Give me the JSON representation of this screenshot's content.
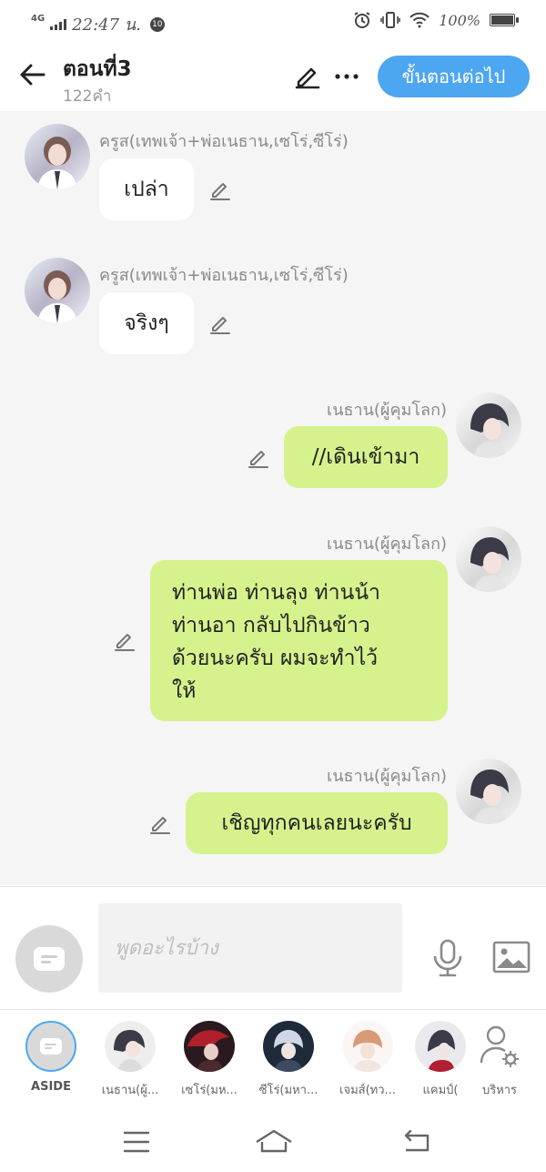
{
  "status_bar": {
    "network": "4G",
    "time": "22:47 น.",
    "notification_count": "10",
    "battery": "100%",
    "battery_level": 1.0
  },
  "header": {
    "title": "ตอนที่3",
    "word_count": "122คำ",
    "next_button": "ขั้นตอนต่อไป",
    "back_icon": "arrow-left-icon",
    "edit_icon": "pencil-icon",
    "more_icon": "more-horizontal-icon"
  },
  "messages": [
    {
      "side": "left",
      "sender": "ครูส(เทพเจ้า+พ่อเนธาน,เซโร่,ซีโร่)",
      "text": "เปล่า"
    },
    {
      "side": "left",
      "sender": "ครูส(เทพเจ้า+พ่อเนธาน,เซโร่,ซีโร่)",
      "text": "จริงๆ"
    },
    {
      "side": "right",
      "sender": "เนธาน(ผู้คุมโลก)",
      "text": "//เดินเข้ามา"
    },
    {
      "side": "right",
      "sender": "เนธาน(ผู้คุมโลก)",
      "lines": [
        "ท่านพ่อ ท่านลุง ท่านน้า",
        "ท่านอา กลับไปกินข้าว",
        "ด้วยนะครับ ผมจะทำไว้",
        "ให้"
      ]
    },
    {
      "side": "right",
      "sender": "เนธาน(ผู้คุมโลก)",
      "text": "เชิญทุกคนเลยนะครับ"
    }
  ],
  "input": {
    "placeholder": "พูดอะไรบ้าง",
    "value": "",
    "mic_icon": "microphone-icon",
    "image_icon": "image-icon"
  },
  "characters": [
    {
      "label": "ASIDE"
    },
    {
      "label": "เนธาน(ผู้..."
    },
    {
      "label": "เซโร่(มห..."
    },
    {
      "label": "ซีโร่(มหา..."
    },
    {
      "label": "เจมส์(ทว..."
    },
    {
      "label": "แคมป์("
    },
    {
      "label": "บริหาร"
    }
  ],
  "nav": {
    "menu_icon": "menu-icon",
    "home_icon": "home-icon",
    "back_icon": "back-icon"
  },
  "colors": {
    "accent": "#4da6f0",
    "bubble_right": "#d6f28d",
    "bubble_left": "#ffffff",
    "chat_bg": "#f5f5f5"
  }
}
